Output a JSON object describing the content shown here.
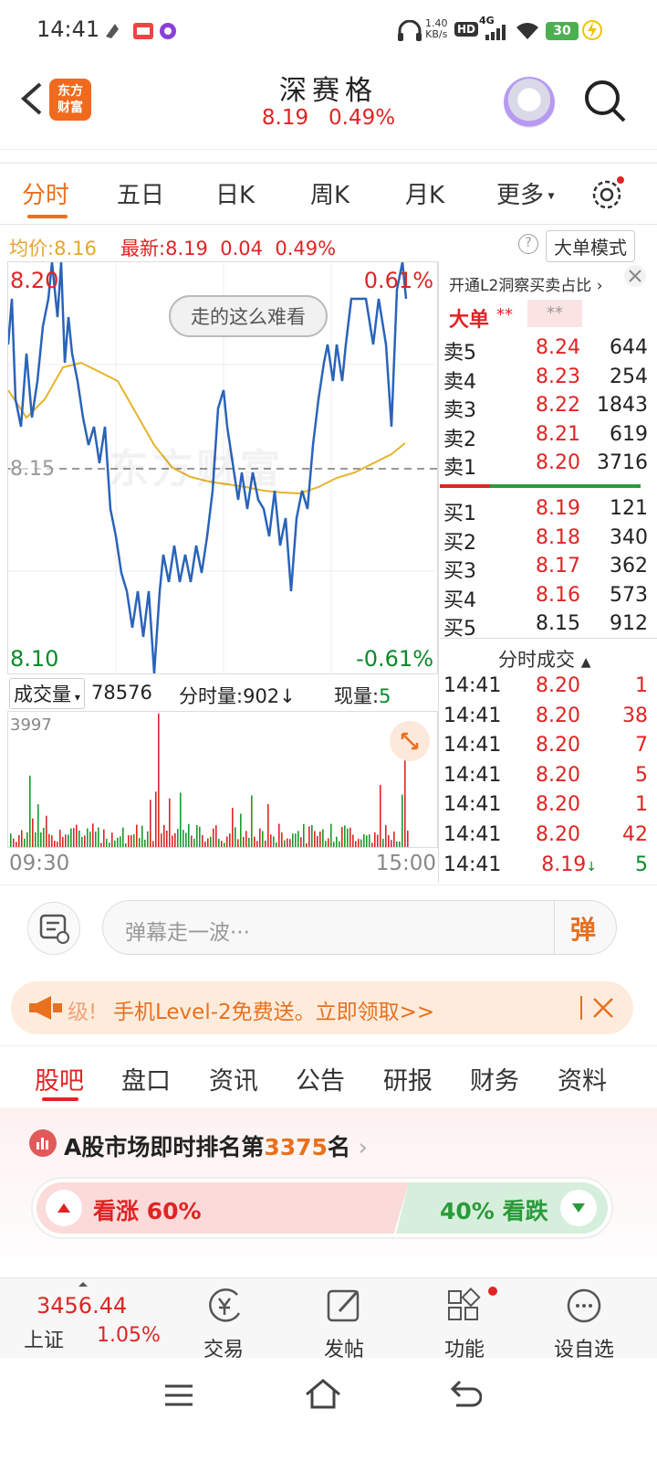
{
  "status": {
    "time": "14:41",
    "speed_top": "1.40",
    "speed_bottom": "KB/s",
    "hd": "HD",
    "signal": "4G",
    "battery": "30"
  },
  "header": {
    "logo_line1": "东方",
    "logo_line2": "财富",
    "title": "深赛格",
    "price": "8.19",
    "change_pct": "0.49%"
  },
  "tabs": [
    "分时",
    "五日",
    "日K",
    "周K",
    "月K",
    "更多",
    "设置"
  ],
  "infoline": {
    "avg_label": "均价:",
    "avg_value": "8.16",
    "latest_label": "最新:",
    "latest_value": "8.19",
    "change": "0.04",
    "pct": "0.49%",
    "help": "?",
    "mode_button": "大单模式"
  },
  "chart_labels": {
    "high": "8.20",
    "high_pct": "0.61%",
    "mid": "8.15",
    "low": "8.10",
    "low_pct": "-0.61%",
    "danmaku": "走的这么难看",
    "watermark": "东方财富",
    "time_start": "09:30",
    "time_end": "15:00"
  },
  "volume_bar": {
    "label": "成交量",
    "value": "78576",
    "fenshi_label": "分时量:",
    "fenshi_value": "902",
    "arrow": "↓",
    "now_label": "现量:",
    "now_value": "5",
    "max": "3997"
  },
  "panel": {
    "l2_label": "开通L2洞察买卖占比",
    "big_label": "大单",
    "big_stars": "**",
    "big_stars2": "**",
    "sell": [
      {
        "n": "卖5",
        "p": "8.24",
        "v": "644"
      },
      {
        "n": "卖4",
        "p": "8.23",
        "v": "254"
      },
      {
        "n": "卖3",
        "p": "8.22",
        "v": "1843"
      },
      {
        "n": "卖2",
        "p": "8.21",
        "v": "619"
      },
      {
        "n": "卖1",
        "p": "8.20",
        "v": "3716"
      }
    ],
    "buy": [
      {
        "n": "买1",
        "p": "8.19",
        "v": "121"
      },
      {
        "n": "买2",
        "p": "8.18",
        "v": "340"
      },
      {
        "n": "买3",
        "p": "8.17",
        "v": "362"
      },
      {
        "n": "买4",
        "p": "8.16",
        "v": "573"
      },
      {
        "n": "买5",
        "p": "8.15",
        "v": "912"
      }
    ],
    "trades_header": "分时成交",
    "trades": [
      {
        "t": "14:41",
        "p": "8.20",
        "v": "1"
      },
      {
        "t": "14:41",
        "p": "8.20",
        "v": "38"
      },
      {
        "t": "14:41",
        "p": "8.20",
        "v": "7"
      },
      {
        "t": "14:41",
        "p": "8.20",
        "v": "5"
      },
      {
        "t": "14:41",
        "p": "8.20",
        "v": "1"
      },
      {
        "t": "14:41",
        "p": "8.20",
        "v": "42"
      },
      {
        "t": "14:41",
        "p": "8.19",
        "v": "5"
      }
    ]
  },
  "input": {
    "placeholder": "弹幕走一波···",
    "danmu_button": "弹"
  },
  "banner": {
    "text_prefix": "级!",
    "text": "手机Level-2免费送。立即领取>>"
  },
  "bottom_tabs": [
    "股吧",
    "盘口",
    "资讯",
    "公告",
    "研报",
    "财务",
    "资料"
  ],
  "rank": {
    "prefix": "A股市场即时排名第",
    "number": "3375",
    "suffix": "名",
    "up_label": "看涨",
    "up_pct": "60%",
    "down_pct": "40%",
    "down_label": "看跌"
  },
  "footer": {
    "index_value": "3456.44",
    "index_name": "上证",
    "index_pct": "1.05%",
    "trade": "交易",
    "post": "发帖",
    "func": "功能",
    "watch": "设自选"
  }
}
